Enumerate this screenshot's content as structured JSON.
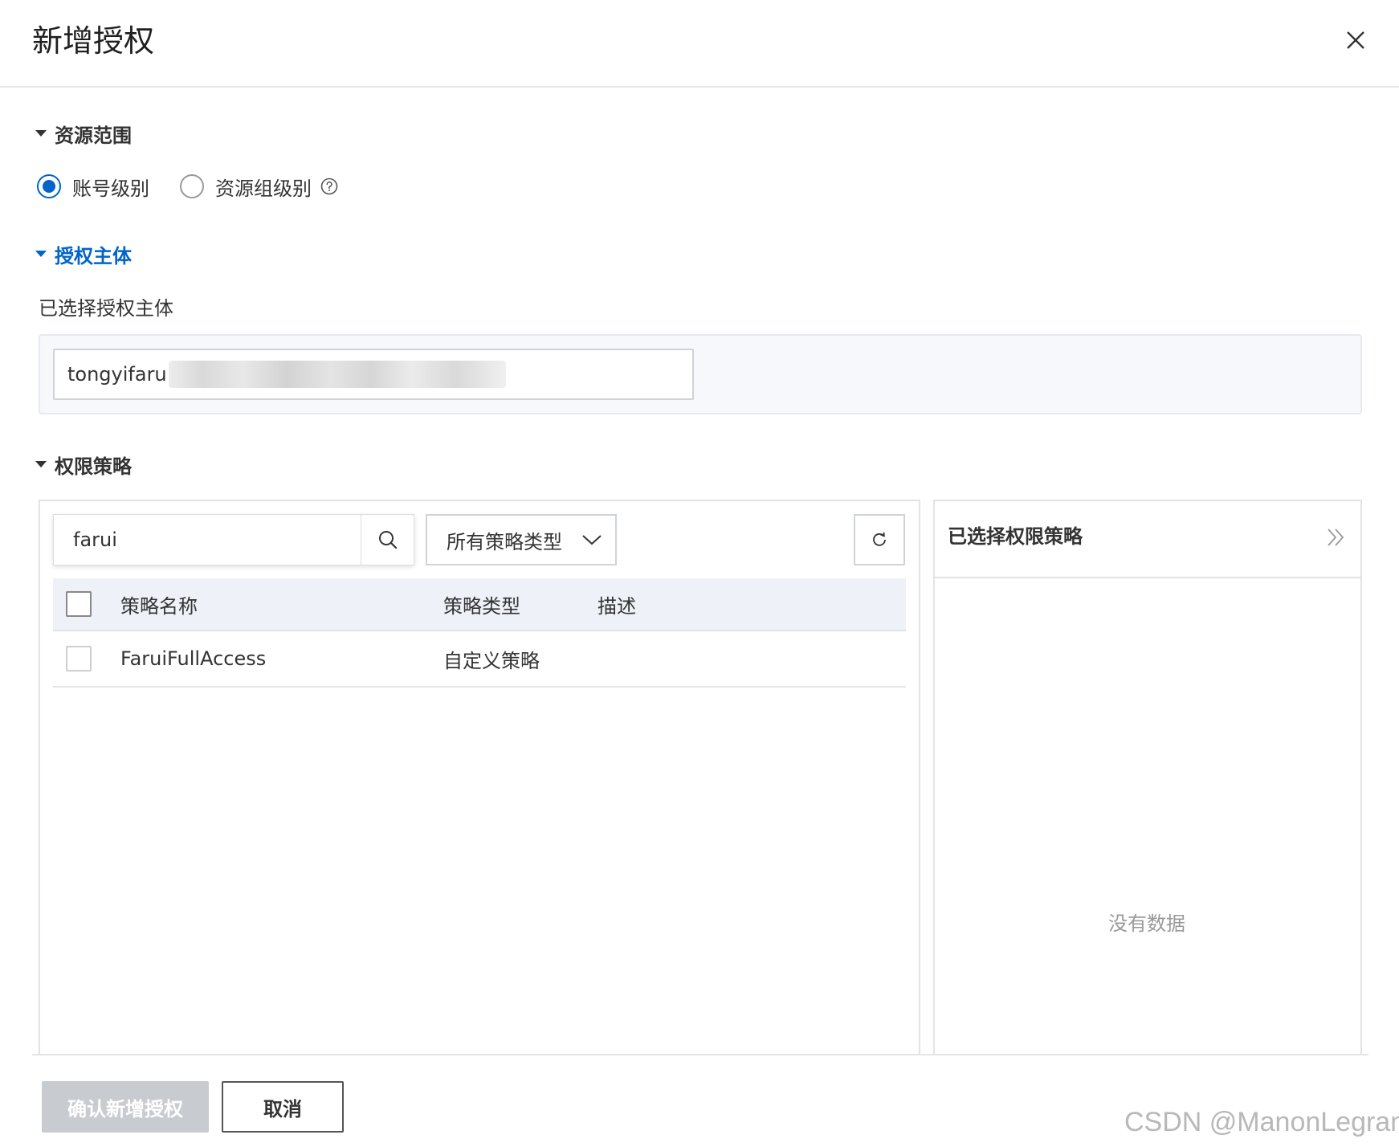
{
  "dialog": {
    "title": "新增授权"
  },
  "resource_scope": {
    "title": "资源范围",
    "options": [
      {
        "label": "账号级别",
        "checked": true
      },
      {
        "label": "资源组级别",
        "checked": false
      }
    ]
  },
  "principal": {
    "title": "授权主体",
    "selected_label": "已选择授权主体",
    "value": "tongyifaru"
  },
  "policy": {
    "title": "权限策略",
    "search": {
      "value": "farui"
    },
    "type_filter": {
      "selected": "所有策略类型"
    },
    "columns": [
      "策略名称",
      "策略类型",
      "描述"
    ],
    "rows": [
      {
        "name": "FaruiFullAccess",
        "type": "自定义策略",
        "description": ""
      }
    ]
  },
  "selected_policies": {
    "title": "已选择权限策略",
    "empty_text": "没有数据"
  },
  "footer": {
    "confirm_label": "确认新增授权",
    "cancel_label": "取消"
  },
  "watermark": "CSDN @ManonLegrand",
  "colors": {
    "accent": "#0064c8",
    "disabled_button": "#c8cbd0"
  }
}
